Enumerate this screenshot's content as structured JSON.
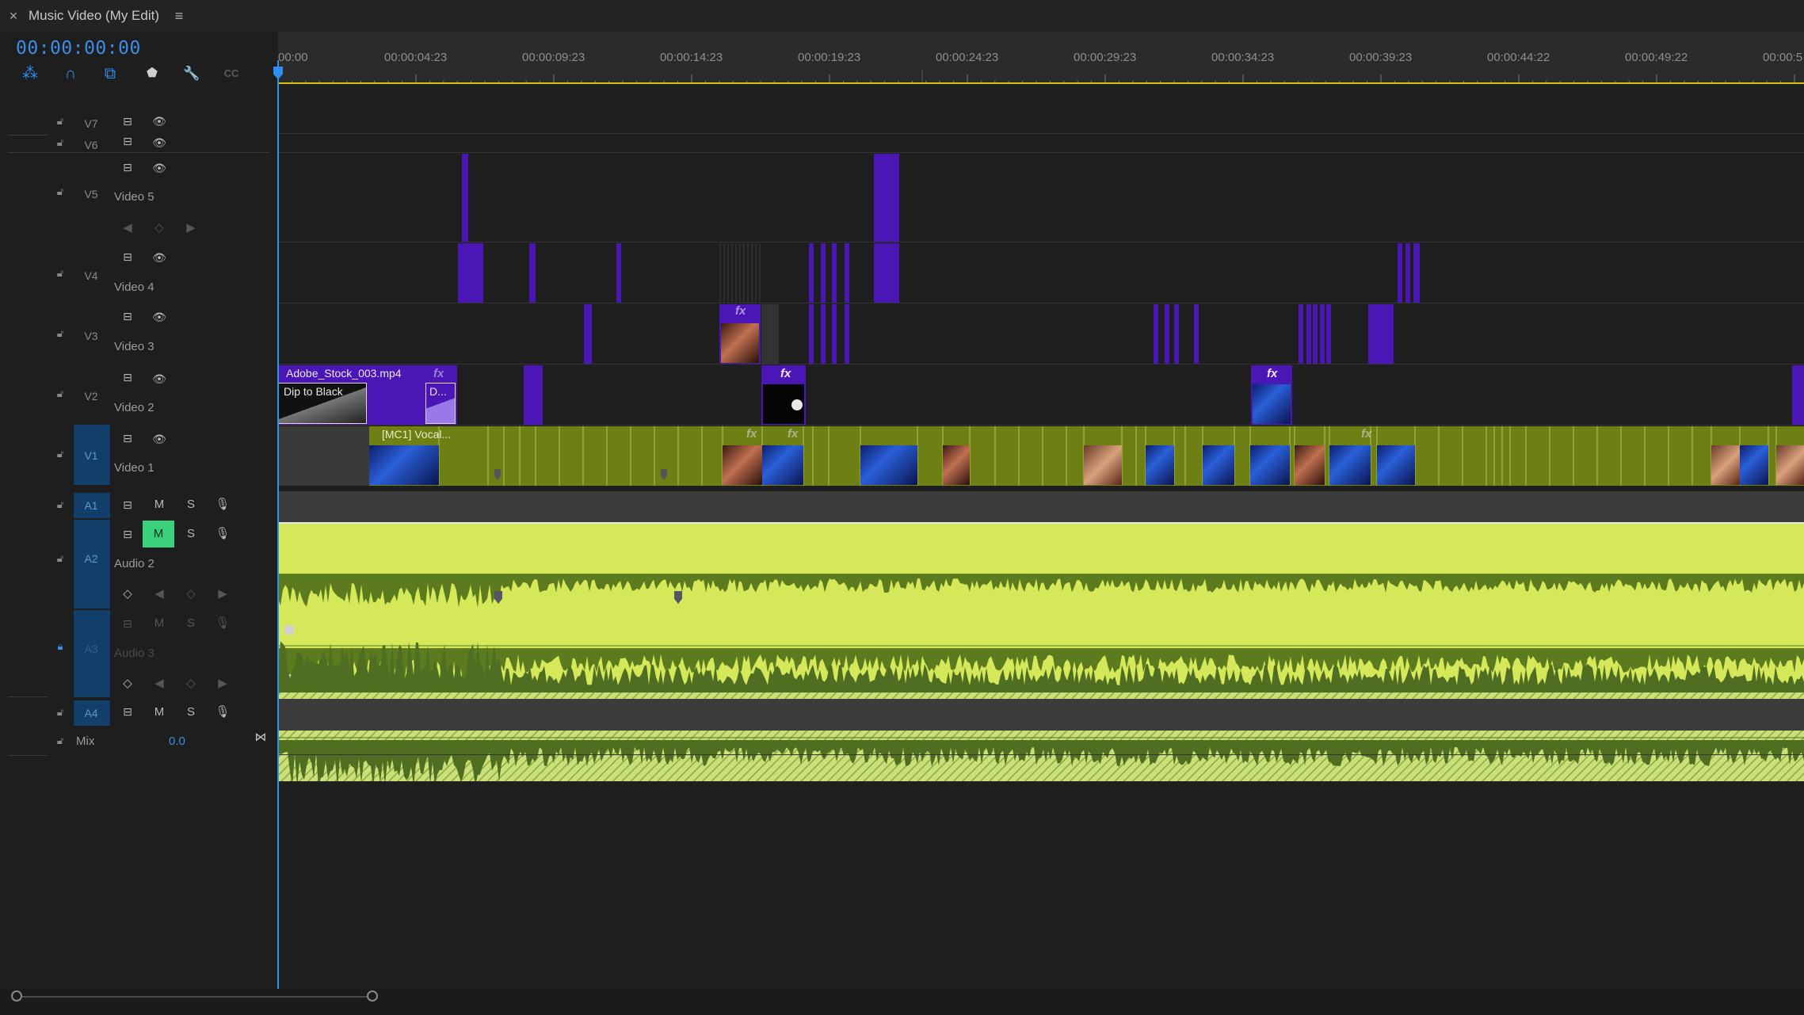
{
  "panel": {
    "close_glyph": "×",
    "title": "Music Video (My Edit)",
    "menu_glyph": "≡"
  },
  "timecode": "00:00:00:00",
  "toolbar": {
    "tools": [
      {
        "name": "nest-sequence-icon",
        "glyph": "⁂"
      },
      {
        "name": "snap-magnet-icon",
        "glyph": "∩"
      },
      {
        "name": "linked-selection-icon",
        "glyph": "⧉"
      },
      {
        "name": "add-marker-icon",
        "glyph": "⬟"
      },
      {
        "name": "timeline-settings-wrench-icon",
        "glyph": "🔧"
      },
      {
        "name": "captions-icon",
        "glyph": "CC"
      }
    ]
  },
  "ruler": {
    "ticks": [
      "00:00",
      "00:00:04:23",
      "00:00:09:23",
      "00:00:14:23",
      "00:00:19:23",
      "00:00:24:23",
      "00:00:29:23",
      "00:00:34:23",
      "00:00:39:23",
      "00:00:44:22",
      "00:00:49:22",
      "00:00:5"
    ]
  },
  "tracks": {
    "v7": {
      "id": "V7"
    },
    "v6": {
      "id": "V6"
    },
    "v5": {
      "id": "V5",
      "name": "Video 5"
    },
    "v4": {
      "id": "V4",
      "name": "Video 4"
    },
    "v3": {
      "id": "V3",
      "name": "Video 3"
    },
    "v2": {
      "id": "V2",
      "name": "Video 2"
    },
    "v1": {
      "id": "V1",
      "name": "Video 1"
    },
    "a1": {
      "id": "A1"
    },
    "a2": {
      "id": "A2",
      "name": "Audio 2"
    },
    "a3": {
      "id": "A3",
      "name": "Audio 3"
    },
    "a4": {
      "id": "A4"
    },
    "mix": {
      "label": "Mix",
      "value": "0.0"
    }
  },
  "buttons": {
    "mute": "M",
    "solo": "S"
  },
  "clips": {
    "v2_main": "Adobe_Stock_003.mp4",
    "v2_transition": "Dip to Black",
    "v2_short": "D...",
    "v1_main": "[MC1] Vocal...",
    "fx": "fx"
  },
  "colors": {
    "accent": "#2f8ff0",
    "video_clip": "#4a16b5",
    "v1_clip": "#6e7f14",
    "audio_wave": "#d4e85a",
    "mute_active": "#3ad07c"
  }
}
